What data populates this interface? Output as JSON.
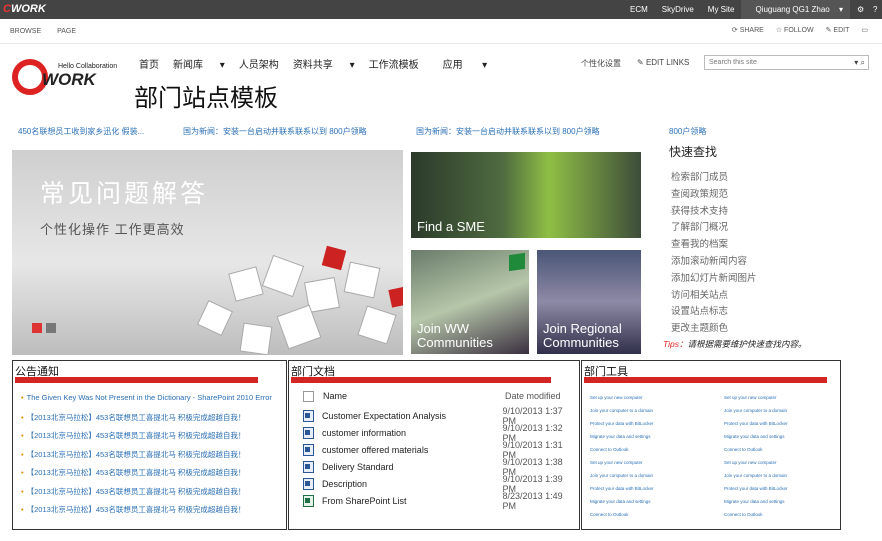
{
  "suite": {
    "logo_pre": "C",
    "logo_main": "WORK",
    "links": [
      "ECM",
      "SkyDrive",
      "My Site"
    ],
    "user": "Qiuguang QG1 Zhao"
  },
  "ribbon": {
    "tabs": [
      "BROWSE",
      "PAGE"
    ],
    "actions": [
      "SHARE",
      "FOLLOW",
      "EDIT"
    ]
  },
  "site": {
    "tagline": "Hello Collaboration",
    "logo": "WORK"
  },
  "topnav": [
    "首页",
    "新闻库",
    "人员架构",
    "资料共享",
    "工作流模板",
    "应用"
  ],
  "personalize": "个性化设置",
  "edit_links": "EDIT LINKS",
  "search_placeholder": "Search this site",
  "page_title": "部门站点模板",
  "news": [
    "450名联想员工收到家乡迅化 假装...",
    "国为新闻：安装一台启动并联系联系以到 800户领略",
    "国为新闻：安装一台启动并联系联系以到 800户领略",
    "800户领略"
  ],
  "banner": {
    "title": "常见问题解答",
    "subtitle": "个性化操作 工作更高效"
  },
  "tiles": {
    "sme": "Find a SME",
    "ww": "Join WW Communities",
    "regional": "Join Regional Communities"
  },
  "quick": {
    "heading": "快速查找",
    "items": [
      "检索部门成员",
      "查阅政策规范",
      "获得技术支持",
      "了解部门概况",
      "查看我的档案",
      "添加滚动新闻内容",
      "添加幻灯片新闻图片",
      "访问相关站点",
      "设置站点标志",
      "更改主题颜色"
    ]
  },
  "tips": {
    "label": "Tips：",
    "text": "请根据需要维护快速查找内容。"
  },
  "announce": {
    "heading": "公告通知",
    "items": [
      "The Given Key Was Not Present in the Dictionary - SharePoint 2010 Error",
      "【2013北京马拉松】453名联想员工喜提北马 积极完成超越自我！",
      "【2013北京马拉松】453名联想员工喜提北马 积极完成超越自我！",
      "【2013北京马拉松】453名联想员工喜提北马 积极完成超越自我！",
      "【2013北京马拉松】453名联想员工喜提北马 积极完成超越自我！",
      "【2013北京马拉松】453名联想员工喜提北马 积极完成超越自我！",
      "【2013北京马拉松】453名联想员工喜提北马 积极完成超越自我！"
    ]
  },
  "docs": {
    "heading": "部门文档",
    "col_name": "Name",
    "col_date": "Date modified",
    "rows": [
      {
        "name": "Customer Expectation Analysis",
        "date": "9/10/2013 1:37 PM"
      },
      {
        "name": "customer information",
        "date": "9/10/2013 1:32 PM"
      },
      {
        "name": "customer offered materials",
        "date": "9/10/2013 1:31 PM"
      },
      {
        "name": "Delivery Standard",
        "date": "9/10/2013 1:38 PM"
      },
      {
        "name": "Description",
        "date": "9/10/2013 1:39 PM"
      },
      {
        "name": "From SharePoint List",
        "date": "8/23/2013 1:49 PM"
      }
    ]
  },
  "tools": {
    "heading": "部门工具",
    "items": [
      "Set up your new computer",
      "Join your computer to a domain",
      "Protect your data with BitLocker",
      "Migrate your data and settings",
      "Connect to Outlook"
    ]
  },
  "colors": {
    "accent": "#d42525",
    "link": "#2a6fb5"
  }
}
